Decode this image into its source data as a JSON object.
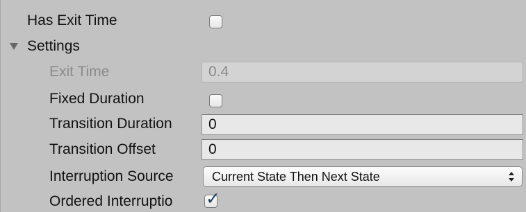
{
  "inspector": {
    "has_exit_time": {
      "label": "Has Exit Time",
      "checked": false
    },
    "settings": {
      "label": "Settings",
      "expanded": true,
      "exit_time": {
        "label": "Exit Time",
        "value": "0.4",
        "disabled": true
      },
      "fixed_duration": {
        "label": "Fixed Duration",
        "checked": false
      },
      "transition_duration": {
        "label": "Transition Duration",
        "value": "0"
      },
      "transition_offset": {
        "label": "Transition Offset",
        "value": "0"
      },
      "interruption_source": {
        "label": "Interruption Source",
        "value": "Current State Then Next State"
      },
      "ordered_interruption": {
        "label": "Ordered Interruptio",
        "checked": true
      }
    }
  },
  "icons": {
    "foldout": "triangle-down-icon",
    "checkmark": "checkmark-icon",
    "dropdown": "updown-arrows-icon"
  },
  "colors": {
    "panel_background": "#c2c2c2",
    "field_background": "#e8e8e8",
    "disabled_text": "#8a8a8a",
    "checkmark": "#1e3f66"
  }
}
